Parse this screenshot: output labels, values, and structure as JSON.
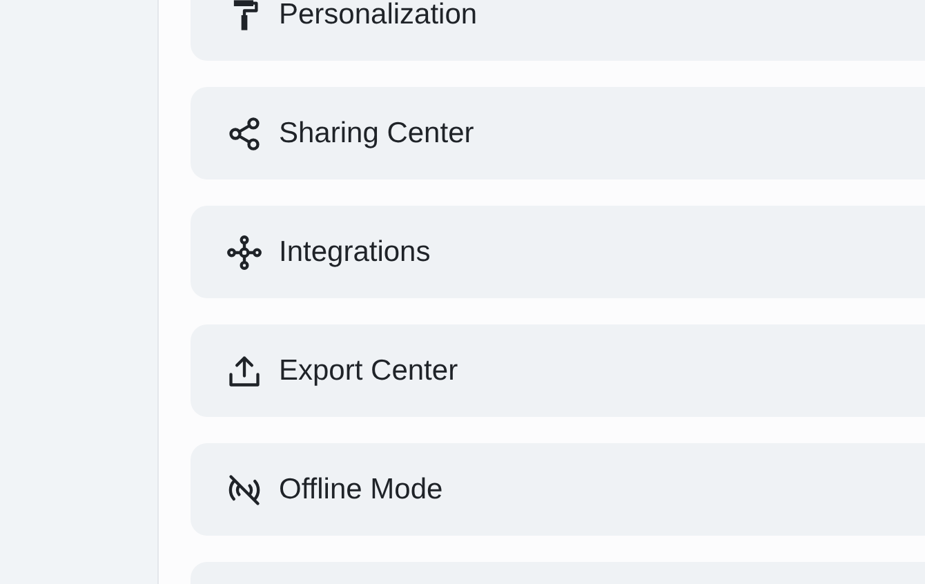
{
  "menu_items": [
    {
      "kind": "roller",
      "label": "Personalization"
    },
    {
      "kind": "share",
      "label": "Sharing Center"
    },
    {
      "kind": "integrations",
      "label": "Integrations"
    },
    {
      "kind": "export",
      "label": "Export Center"
    },
    {
      "kind": "offline",
      "label": "Offline Mode"
    }
  ]
}
